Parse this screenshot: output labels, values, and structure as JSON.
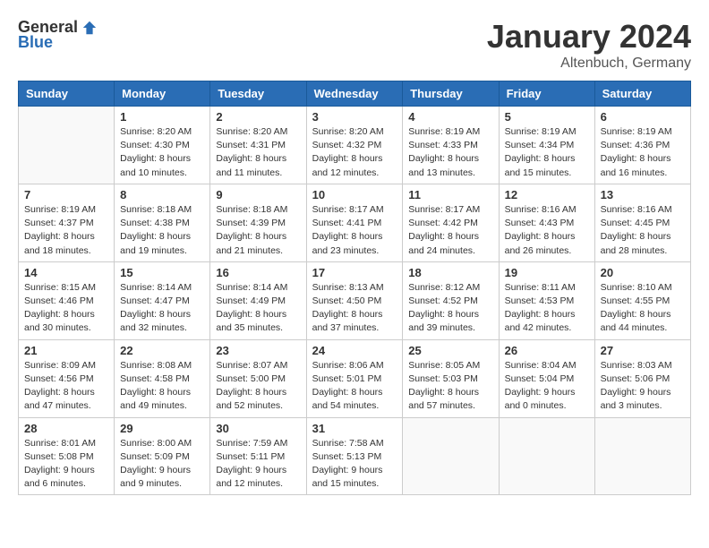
{
  "logo": {
    "general": "General",
    "blue": "Blue"
  },
  "title": "January 2024",
  "location": "Altenbuch, Germany",
  "weekdays": [
    "Sunday",
    "Monday",
    "Tuesday",
    "Wednesday",
    "Thursday",
    "Friday",
    "Saturday"
  ],
  "weeks": [
    [
      {
        "day": "",
        "info": ""
      },
      {
        "day": "1",
        "info": "Sunrise: 8:20 AM\nSunset: 4:30 PM\nDaylight: 8 hours\nand 10 minutes."
      },
      {
        "day": "2",
        "info": "Sunrise: 8:20 AM\nSunset: 4:31 PM\nDaylight: 8 hours\nand 11 minutes."
      },
      {
        "day": "3",
        "info": "Sunrise: 8:20 AM\nSunset: 4:32 PM\nDaylight: 8 hours\nand 12 minutes."
      },
      {
        "day": "4",
        "info": "Sunrise: 8:19 AM\nSunset: 4:33 PM\nDaylight: 8 hours\nand 13 minutes."
      },
      {
        "day": "5",
        "info": "Sunrise: 8:19 AM\nSunset: 4:34 PM\nDaylight: 8 hours\nand 15 minutes."
      },
      {
        "day": "6",
        "info": "Sunrise: 8:19 AM\nSunset: 4:36 PM\nDaylight: 8 hours\nand 16 minutes."
      }
    ],
    [
      {
        "day": "7",
        "info": "Sunrise: 8:19 AM\nSunset: 4:37 PM\nDaylight: 8 hours\nand 18 minutes."
      },
      {
        "day": "8",
        "info": "Sunrise: 8:18 AM\nSunset: 4:38 PM\nDaylight: 8 hours\nand 19 minutes."
      },
      {
        "day": "9",
        "info": "Sunrise: 8:18 AM\nSunset: 4:39 PM\nDaylight: 8 hours\nand 21 minutes."
      },
      {
        "day": "10",
        "info": "Sunrise: 8:17 AM\nSunset: 4:41 PM\nDaylight: 8 hours\nand 23 minutes."
      },
      {
        "day": "11",
        "info": "Sunrise: 8:17 AM\nSunset: 4:42 PM\nDaylight: 8 hours\nand 24 minutes."
      },
      {
        "day": "12",
        "info": "Sunrise: 8:16 AM\nSunset: 4:43 PM\nDaylight: 8 hours\nand 26 minutes."
      },
      {
        "day": "13",
        "info": "Sunrise: 8:16 AM\nSunset: 4:45 PM\nDaylight: 8 hours\nand 28 minutes."
      }
    ],
    [
      {
        "day": "14",
        "info": "Sunrise: 8:15 AM\nSunset: 4:46 PM\nDaylight: 8 hours\nand 30 minutes."
      },
      {
        "day": "15",
        "info": "Sunrise: 8:14 AM\nSunset: 4:47 PM\nDaylight: 8 hours\nand 32 minutes."
      },
      {
        "day": "16",
        "info": "Sunrise: 8:14 AM\nSunset: 4:49 PM\nDaylight: 8 hours\nand 35 minutes."
      },
      {
        "day": "17",
        "info": "Sunrise: 8:13 AM\nSunset: 4:50 PM\nDaylight: 8 hours\nand 37 minutes."
      },
      {
        "day": "18",
        "info": "Sunrise: 8:12 AM\nSunset: 4:52 PM\nDaylight: 8 hours\nand 39 minutes."
      },
      {
        "day": "19",
        "info": "Sunrise: 8:11 AM\nSunset: 4:53 PM\nDaylight: 8 hours\nand 42 minutes."
      },
      {
        "day": "20",
        "info": "Sunrise: 8:10 AM\nSunset: 4:55 PM\nDaylight: 8 hours\nand 44 minutes."
      }
    ],
    [
      {
        "day": "21",
        "info": "Sunrise: 8:09 AM\nSunset: 4:56 PM\nDaylight: 8 hours\nand 47 minutes."
      },
      {
        "day": "22",
        "info": "Sunrise: 8:08 AM\nSunset: 4:58 PM\nDaylight: 8 hours\nand 49 minutes."
      },
      {
        "day": "23",
        "info": "Sunrise: 8:07 AM\nSunset: 5:00 PM\nDaylight: 8 hours\nand 52 minutes."
      },
      {
        "day": "24",
        "info": "Sunrise: 8:06 AM\nSunset: 5:01 PM\nDaylight: 8 hours\nand 54 minutes."
      },
      {
        "day": "25",
        "info": "Sunrise: 8:05 AM\nSunset: 5:03 PM\nDaylight: 8 hours\nand 57 minutes."
      },
      {
        "day": "26",
        "info": "Sunrise: 8:04 AM\nSunset: 5:04 PM\nDaylight: 9 hours\nand 0 minutes."
      },
      {
        "day": "27",
        "info": "Sunrise: 8:03 AM\nSunset: 5:06 PM\nDaylight: 9 hours\nand 3 minutes."
      }
    ],
    [
      {
        "day": "28",
        "info": "Sunrise: 8:01 AM\nSunset: 5:08 PM\nDaylight: 9 hours\nand 6 minutes."
      },
      {
        "day": "29",
        "info": "Sunrise: 8:00 AM\nSunset: 5:09 PM\nDaylight: 9 hours\nand 9 minutes."
      },
      {
        "day": "30",
        "info": "Sunrise: 7:59 AM\nSunset: 5:11 PM\nDaylight: 9 hours\nand 12 minutes."
      },
      {
        "day": "31",
        "info": "Sunrise: 7:58 AM\nSunset: 5:13 PM\nDaylight: 9 hours\nand 15 minutes."
      },
      {
        "day": "",
        "info": ""
      },
      {
        "day": "",
        "info": ""
      },
      {
        "day": "",
        "info": ""
      }
    ]
  ]
}
